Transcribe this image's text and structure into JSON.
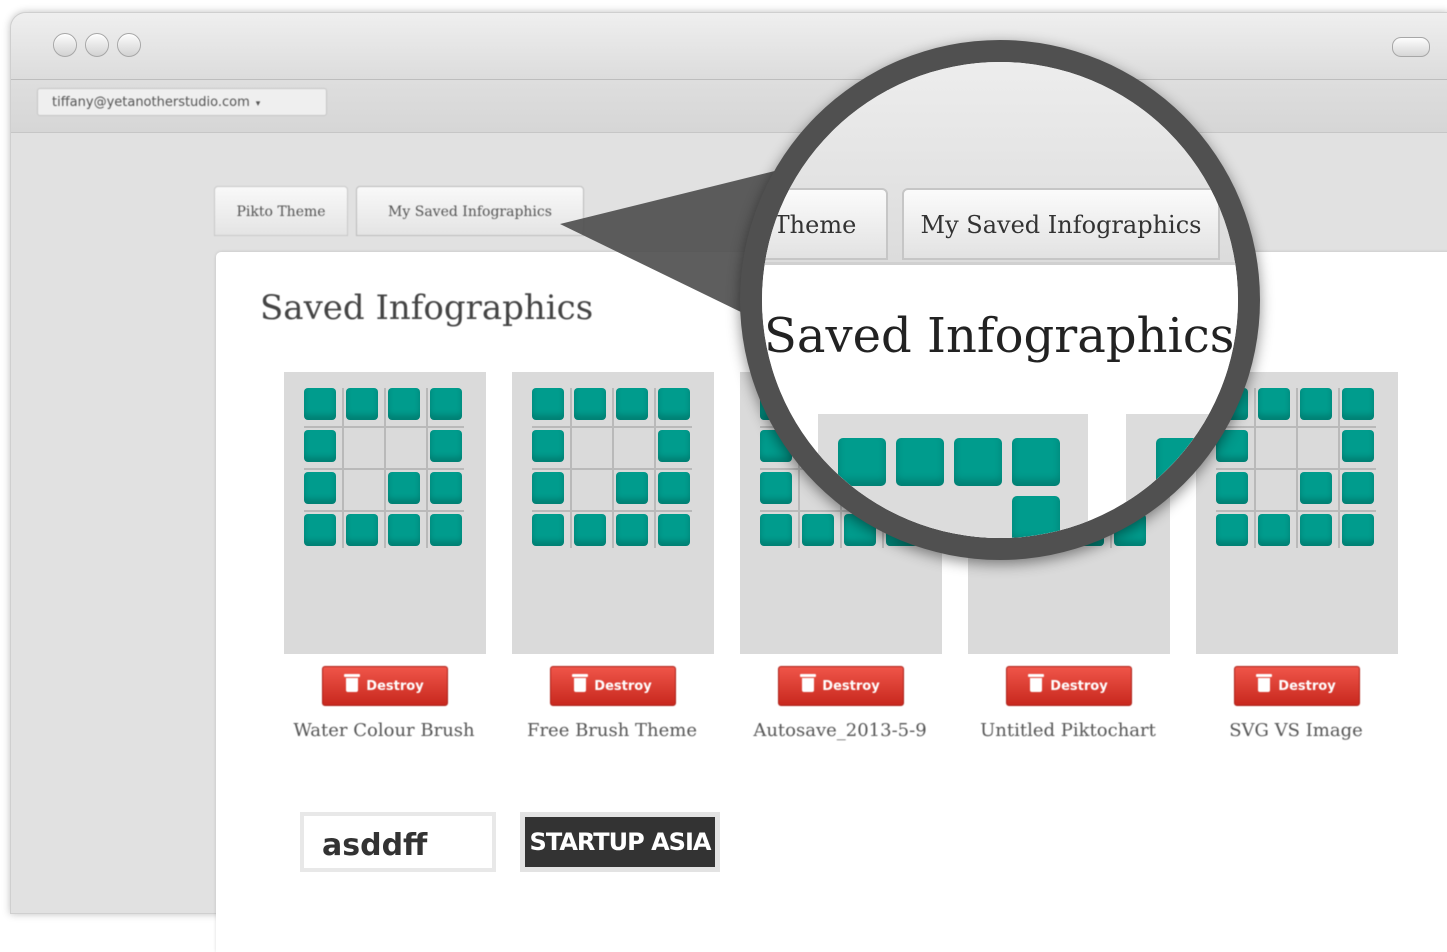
{
  "browser": {
    "account_email": "tiffany@yetanotherstudio.com",
    "account_caret": "▾"
  },
  "tabs": [
    {
      "label": "Pikto Theme"
    },
    {
      "label": "My Saved Infographics"
    }
  ],
  "main": {
    "heading": "Saved Infographics",
    "destroy_label": "Destroy",
    "cards": [
      {
        "name": "Water Colour Brush"
      },
      {
        "name": "Free Brush Theme"
      },
      {
        "name": "Autosave_2013-5-9"
      },
      {
        "name": "Untitled Piktochart"
      },
      {
        "name": "SVG VS Image"
      }
    ],
    "more_cards": [
      {
        "text": "asddff"
      },
      {
        "text": "STARTUP ASIA"
      }
    ]
  },
  "magnifier": {
    "tab_partial": "Theme",
    "tab_active": "My Saved Infographics",
    "heading": "Saved Infographics"
  },
  "colors": {
    "tile": "#009c8d",
    "destroy": "#d9362b",
    "lens_ring": "#505050"
  }
}
